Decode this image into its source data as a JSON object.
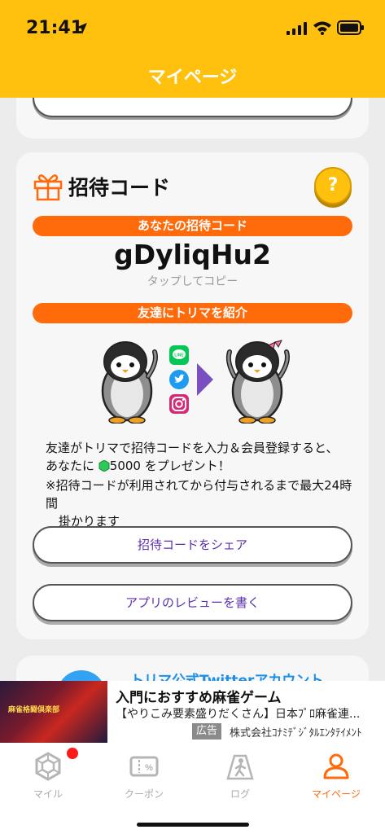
{
  "status_bar": {
    "time": "21:41"
  },
  "header": {
    "title": "マイページ"
  },
  "invite": {
    "title": "招待コード",
    "help_label": "?",
    "code_header": "あなたの招待コード",
    "code": "gDyliqHu2",
    "tap_to_copy": "タップしてコピー",
    "intro_header": "友達にトリマを紹介",
    "description_line1": "友達がトリマで招待コードを入力＆会員登録すると、",
    "description_prefix": "あなたに",
    "reward_amount": "5000",
    "description_suffix": "をプレゼント！",
    "note_line1": "※招待コードが利用されてから付与されるまで最大24時間",
    "note_line2": "掛かります",
    "share_button": "招待コードをシェア",
    "review_button": "アプリのレビューを書く"
  },
  "next_card": {
    "title": "トリマ公式Twitterアカウント"
  },
  "ad": {
    "title": "入門におすすめ麻雀ゲーム",
    "description": "【やりこみ要素盛りだくさん】日本ﾌﾟﾛ麻雀連...",
    "badge": "広告",
    "sponsor": "株式会社ｺﾅﾐﾃﾞｼﾞﾀﾙｴﾝﾀﾃｲﾒﾝﾄ",
    "image_text": "麻雀格闘倶楽部"
  },
  "tabs": [
    {
      "label": "マイル",
      "icon": "hexagon-gem-icon",
      "active": false
    },
    {
      "label": "クーポン",
      "icon": "coupon-icon",
      "active": false
    },
    {
      "label": "ログ",
      "icon": "walking-person-icon",
      "active": false
    },
    {
      "label": "マイページ",
      "icon": "person-icon",
      "active": true
    }
  ],
  "colors": {
    "header": "#ffc10e",
    "accent_orange": "#ff6a0a",
    "button_text": "#5b2fb0",
    "notification": "#ff1a1a"
  }
}
